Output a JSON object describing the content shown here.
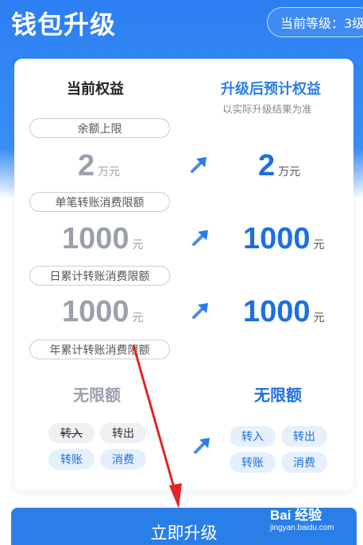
{
  "header": {
    "title": "钱包升级",
    "level_text": "当前等级：3级"
  },
  "columns": {
    "current": "当前权益",
    "upgraded": "升级后预计权益",
    "upgraded_note": "以实际升级结果为准"
  },
  "rows": [
    {
      "label": "余额上限",
      "current_value": "2",
      "current_unit": "万元",
      "new_value": "2",
      "new_unit": "万元"
    },
    {
      "label": "单笔转账消费限额",
      "current_value": "1000",
      "current_unit": "元",
      "new_value": "1000",
      "new_unit": "元"
    },
    {
      "label": "日累计转账消费限额",
      "current_value": "1000",
      "current_unit": "元",
      "new_value": "1000",
      "new_unit": "元"
    },
    {
      "label": "年累计转账消费限额",
      "current_value": "无限额",
      "new_value": "无限额"
    }
  ],
  "features": {
    "current": [
      "转入",
      "转出",
      "转账",
      "消费"
    ],
    "upgraded": [
      "转入",
      "转出",
      "转账",
      "消费"
    ]
  },
  "cta": {
    "label": "立即升级"
  },
  "watermark": {
    "brand": "Bai 经验",
    "url": "jingyan.baidu.com"
  },
  "colors": {
    "primary": "#2a7ee8",
    "annotation": "#e02424"
  }
}
